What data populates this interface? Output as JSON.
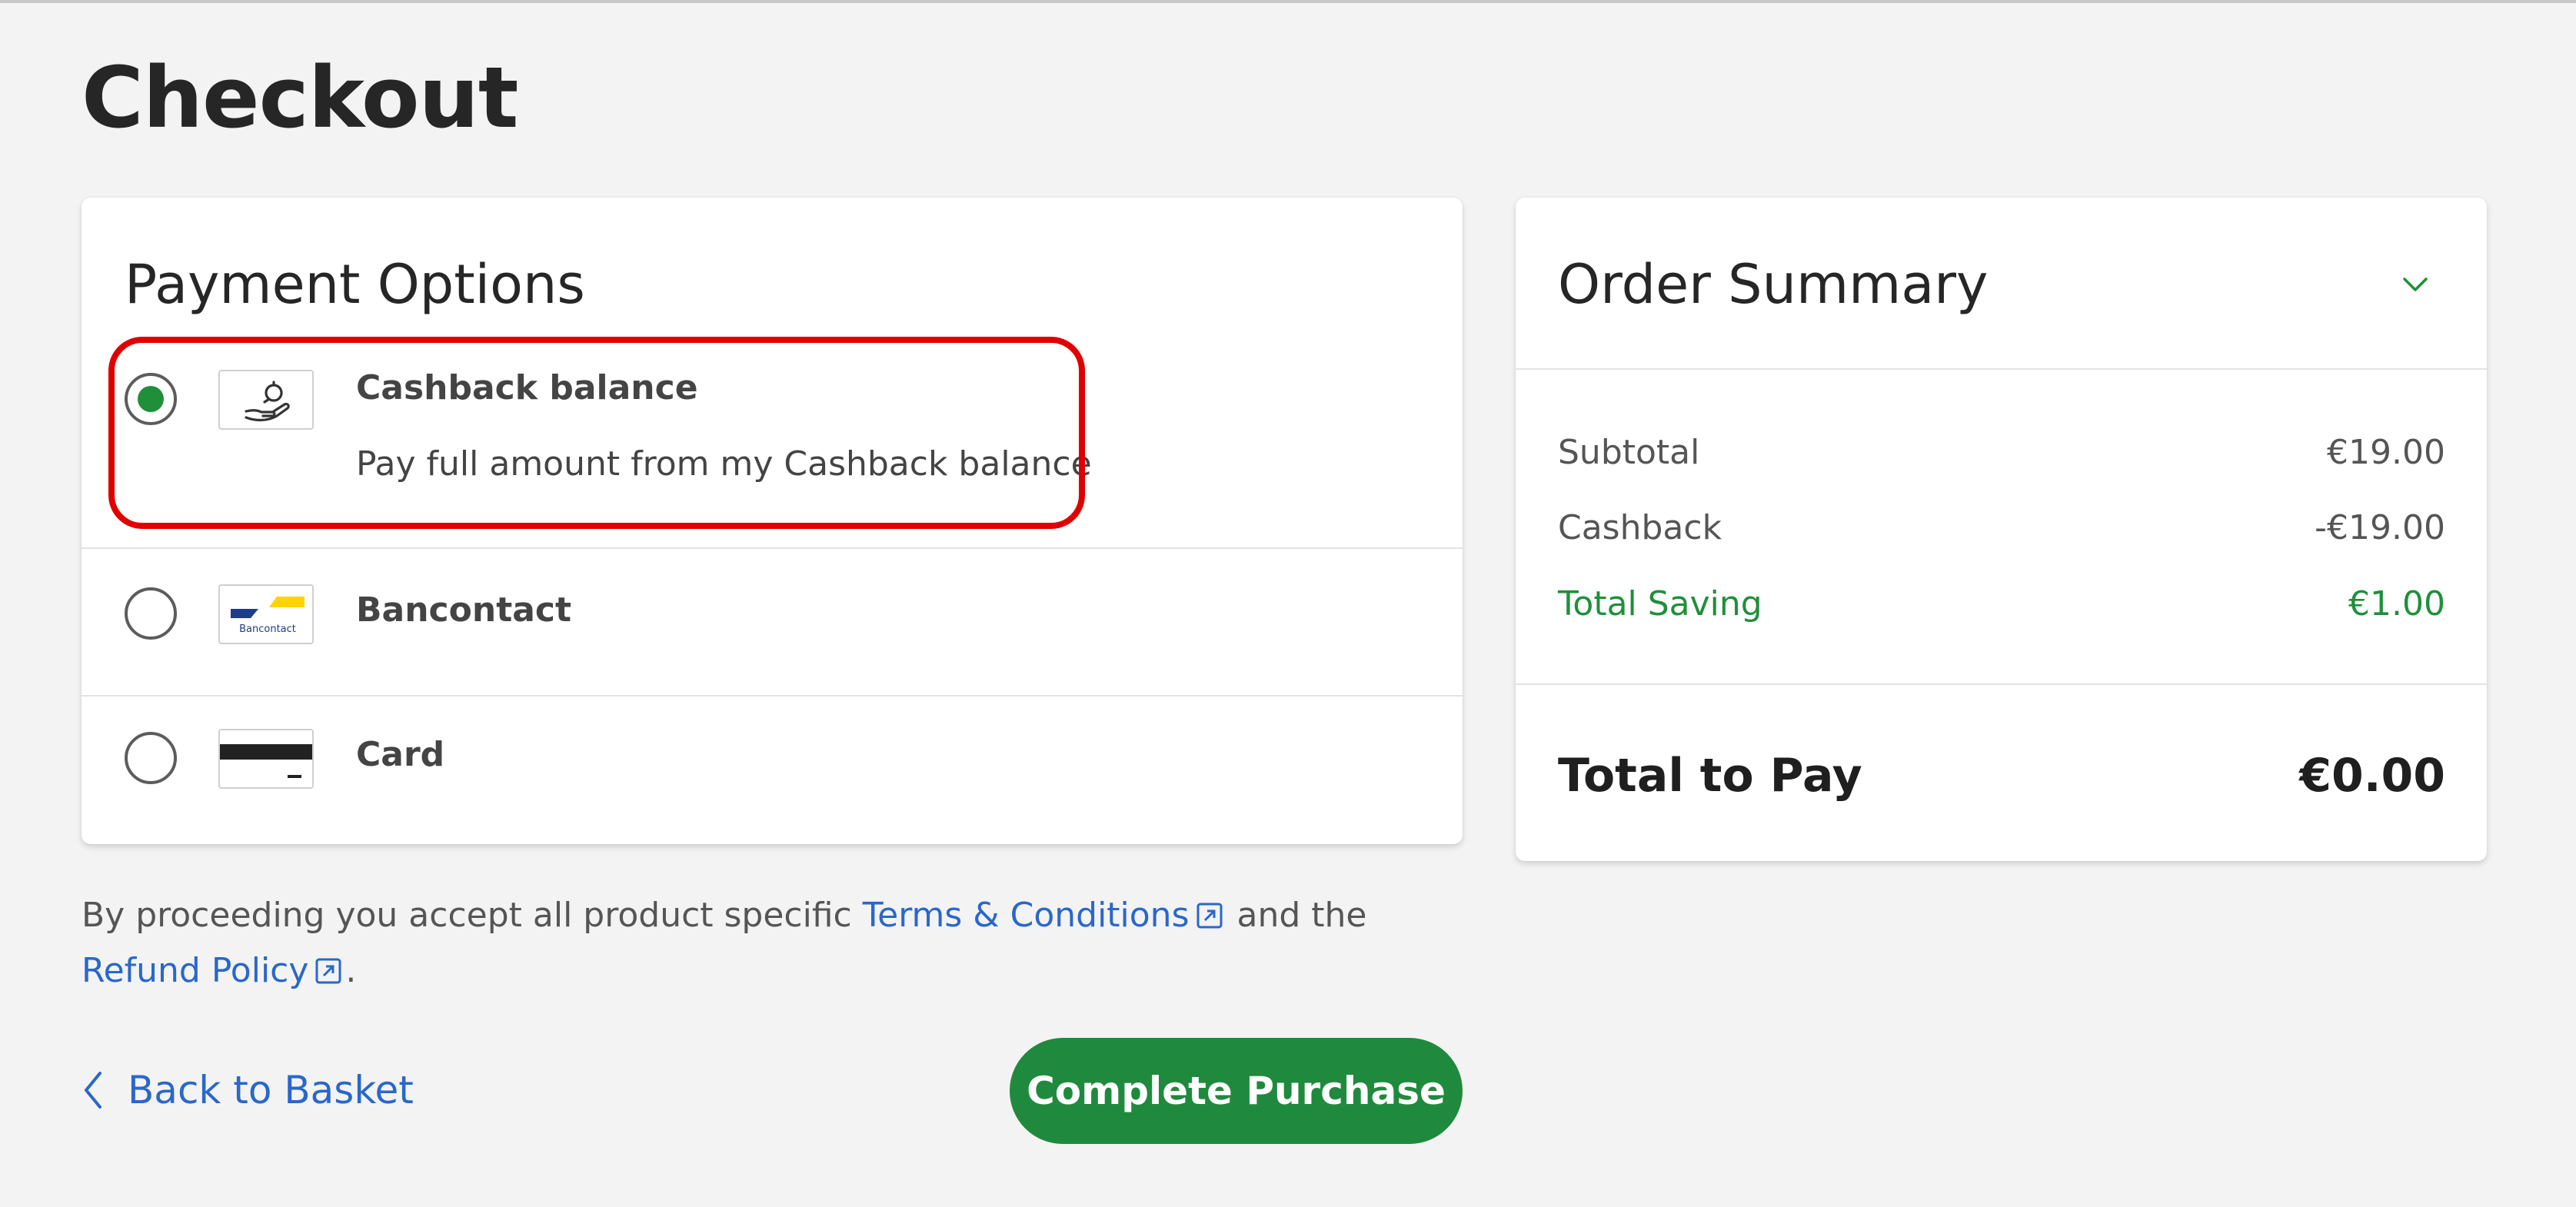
{
  "page": {
    "title": "Checkout"
  },
  "payment": {
    "title": "Payment Options",
    "options": [
      {
        "label": "Cashback balance",
        "description": "Pay full amount from my Cashback balance",
        "selected": true,
        "icon": "hand-coin-icon"
      },
      {
        "label": "Bancontact",
        "selected": false,
        "icon": "bancontact-logo",
        "logo_text": "Bancontact"
      },
      {
        "label": "Card",
        "selected": false,
        "icon": "card-icon"
      }
    ]
  },
  "summary": {
    "title": "Order Summary",
    "rows": [
      {
        "label": "Subtotal",
        "value": "€19.00"
      },
      {
        "label": "Cashback",
        "value": "-€19.00"
      },
      {
        "label": "Total Saving",
        "value": "€1.00"
      }
    ],
    "total_label": "Total to Pay",
    "total_value": "€0.00"
  },
  "terms": {
    "prefix": "By proceeding you accept all product specific ",
    "terms_link": "Terms & Conditions",
    "middle": " and the",
    "refund_link": "Refund Policy",
    "suffix": "."
  },
  "actions": {
    "back_label": "Back to Basket",
    "purchase_label": "Complete Purchase"
  },
  "colors": {
    "accent_green": "#1f8a3d",
    "link_blue": "#2a67c9",
    "highlight_red": "#e00000"
  }
}
